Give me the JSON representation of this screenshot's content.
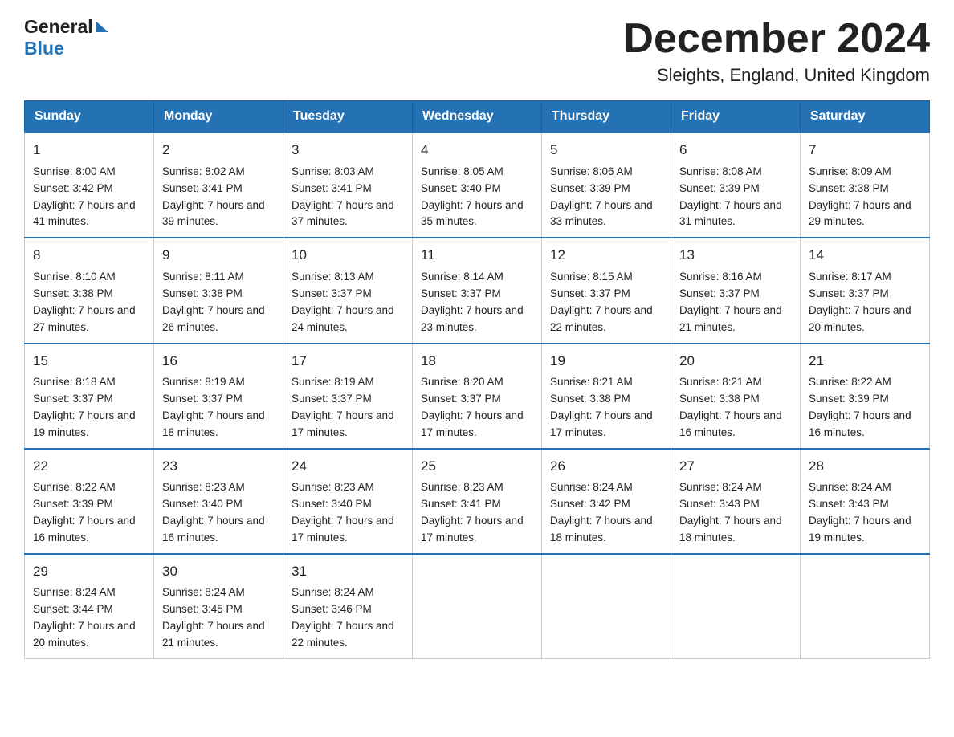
{
  "header": {
    "title": "December 2024",
    "subtitle": "Sleights, England, United Kingdom",
    "logo_general": "General",
    "logo_blue": "Blue"
  },
  "calendar": {
    "weekdays": [
      "Sunday",
      "Monday",
      "Tuesday",
      "Wednesday",
      "Thursday",
      "Friday",
      "Saturday"
    ],
    "weeks": [
      [
        {
          "day": "1",
          "sunrise": "8:00 AM",
          "sunset": "3:42 PM",
          "daylight": "7 hours and 41 minutes."
        },
        {
          "day": "2",
          "sunrise": "8:02 AM",
          "sunset": "3:41 PM",
          "daylight": "7 hours and 39 minutes."
        },
        {
          "day": "3",
          "sunrise": "8:03 AM",
          "sunset": "3:41 PM",
          "daylight": "7 hours and 37 minutes."
        },
        {
          "day": "4",
          "sunrise": "8:05 AM",
          "sunset": "3:40 PM",
          "daylight": "7 hours and 35 minutes."
        },
        {
          "day": "5",
          "sunrise": "8:06 AM",
          "sunset": "3:39 PM",
          "daylight": "7 hours and 33 minutes."
        },
        {
          "day": "6",
          "sunrise": "8:08 AM",
          "sunset": "3:39 PM",
          "daylight": "7 hours and 31 minutes."
        },
        {
          "day": "7",
          "sunrise": "8:09 AM",
          "sunset": "3:38 PM",
          "daylight": "7 hours and 29 minutes."
        }
      ],
      [
        {
          "day": "8",
          "sunrise": "8:10 AM",
          "sunset": "3:38 PM",
          "daylight": "7 hours and 27 minutes."
        },
        {
          "day": "9",
          "sunrise": "8:11 AM",
          "sunset": "3:38 PM",
          "daylight": "7 hours and 26 minutes."
        },
        {
          "day": "10",
          "sunrise": "8:13 AM",
          "sunset": "3:37 PM",
          "daylight": "7 hours and 24 minutes."
        },
        {
          "day": "11",
          "sunrise": "8:14 AM",
          "sunset": "3:37 PM",
          "daylight": "7 hours and 23 minutes."
        },
        {
          "day": "12",
          "sunrise": "8:15 AM",
          "sunset": "3:37 PM",
          "daylight": "7 hours and 22 minutes."
        },
        {
          "day": "13",
          "sunrise": "8:16 AM",
          "sunset": "3:37 PM",
          "daylight": "7 hours and 21 minutes."
        },
        {
          "day": "14",
          "sunrise": "8:17 AM",
          "sunset": "3:37 PM",
          "daylight": "7 hours and 20 minutes."
        }
      ],
      [
        {
          "day": "15",
          "sunrise": "8:18 AM",
          "sunset": "3:37 PM",
          "daylight": "7 hours and 19 minutes."
        },
        {
          "day": "16",
          "sunrise": "8:19 AM",
          "sunset": "3:37 PM",
          "daylight": "7 hours and 18 minutes."
        },
        {
          "day": "17",
          "sunrise": "8:19 AM",
          "sunset": "3:37 PM",
          "daylight": "7 hours and 17 minutes."
        },
        {
          "day": "18",
          "sunrise": "8:20 AM",
          "sunset": "3:37 PM",
          "daylight": "7 hours and 17 minutes."
        },
        {
          "day": "19",
          "sunrise": "8:21 AM",
          "sunset": "3:38 PM",
          "daylight": "7 hours and 17 minutes."
        },
        {
          "day": "20",
          "sunrise": "8:21 AM",
          "sunset": "3:38 PM",
          "daylight": "7 hours and 16 minutes."
        },
        {
          "day": "21",
          "sunrise": "8:22 AM",
          "sunset": "3:39 PM",
          "daylight": "7 hours and 16 minutes."
        }
      ],
      [
        {
          "day": "22",
          "sunrise": "8:22 AM",
          "sunset": "3:39 PM",
          "daylight": "7 hours and 16 minutes."
        },
        {
          "day": "23",
          "sunrise": "8:23 AM",
          "sunset": "3:40 PM",
          "daylight": "7 hours and 16 minutes."
        },
        {
          "day": "24",
          "sunrise": "8:23 AM",
          "sunset": "3:40 PM",
          "daylight": "7 hours and 17 minutes."
        },
        {
          "day": "25",
          "sunrise": "8:23 AM",
          "sunset": "3:41 PM",
          "daylight": "7 hours and 17 minutes."
        },
        {
          "day": "26",
          "sunrise": "8:24 AM",
          "sunset": "3:42 PM",
          "daylight": "7 hours and 18 minutes."
        },
        {
          "day": "27",
          "sunrise": "8:24 AM",
          "sunset": "3:43 PM",
          "daylight": "7 hours and 18 minutes."
        },
        {
          "day": "28",
          "sunrise": "8:24 AM",
          "sunset": "3:43 PM",
          "daylight": "7 hours and 19 minutes."
        }
      ],
      [
        {
          "day": "29",
          "sunrise": "8:24 AM",
          "sunset": "3:44 PM",
          "daylight": "7 hours and 20 minutes."
        },
        {
          "day": "30",
          "sunrise": "8:24 AM",
          "sunset": "3:45 PM",
          "daylight": "7 hours and 21 minutes."
        },
        {
          "day": "31",
          "sunrise": "8:24 AM",
          "sunset": "3:46 PM",
          "daylight": "7 hours and 22 minutes."
        },
        null,
        null,
        null,
        null
      ]
    ],
    "sunrise_label": "Sunrise:",
    "sunset_label": "Sunset:",
    "daylight_label": "Daylight:"
  }
}
